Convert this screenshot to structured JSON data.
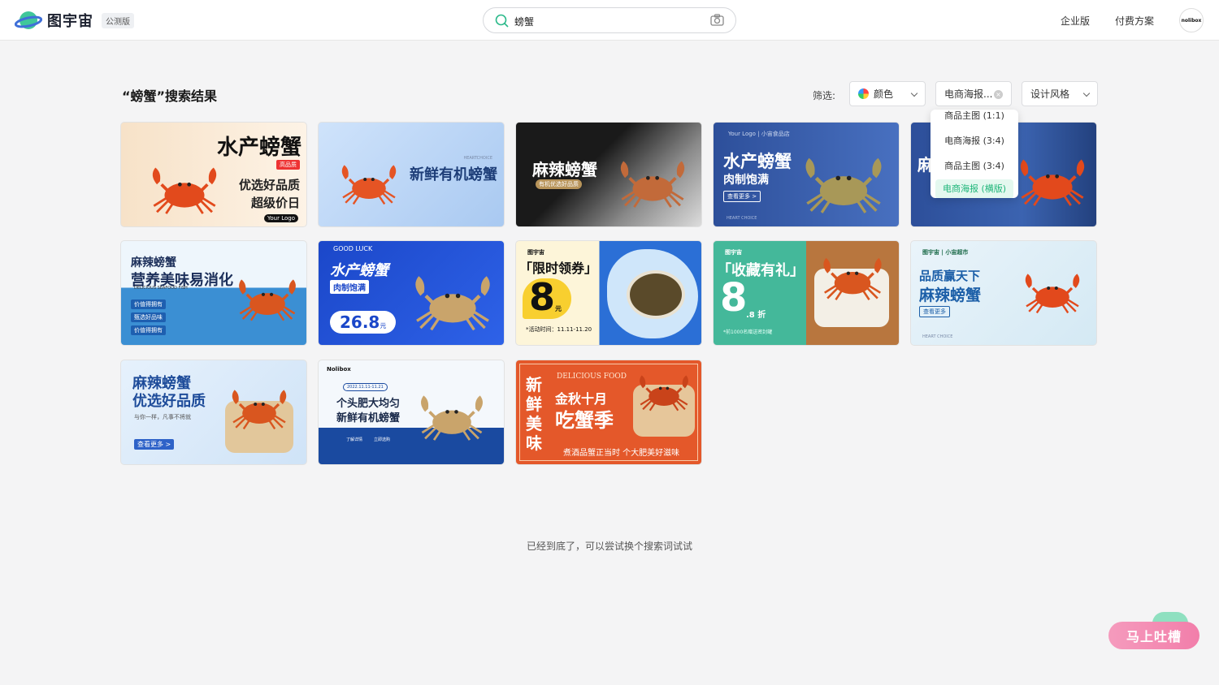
{
  "header": {
    "logo_text": "图宇宙",
    "beta_badge": "公测版",
    "search_value": "螃蟹",
    "nav": [
      "企业版",
      "付费方案"
    ],
    "avatar_text": "nolibox"
  },
  "results": {
    "title": "“螃蟹”搜索结果",
    "filter_label": "筛选:",
    "filters": {
      "color": "颜色",
      "type": "电商海报...",
      "style": "设计风格"
    },
    "dropdown_options": [
      "商品主图 (1:1)",
      "电商海报 (3:4)",
      "商品主图 (3:4)",
      "电商海报 (横版)"
    ],
    "end_text": "已经到底了，可以尝试换个搜索词试试"
  },
  "cards": [
    {
      "title": "水产螃蟹",
      "badge": "高品质",
      "line1": "优选好品质",
      "line2": "超级价日",
      "logo": "Your Logo"
    },
    {
      "title": "新鲜有机螃蟹",
      "small": "HEARTCHOICE"
    },
    {
      "title": "麻辣螃蟹",
      "tag": "有机优选好品质"
    },
    {
      "title": "水产螃蟹",
      "sub": "肉制饱满",
      "btn": "查看更多 >",
      "shop": "Your Logo | 小宙食品店",
      "foot": "HEART CHOICE"
    },
    {
      "title": "麻辣螃蟹"
    },
    {
      "title": "麻辣螃蟹",
      "sub": "营养美味易消化",
      "en": "DELICIOUS SEAFOOD FISH",
      "tags": [
        "价值得拥有",
        "甄选好品味",
        "价值得拥有"
      ]
    },
    {
      "title": "水产螃蟹",
      "sub": "肉制饱满",
      "price": "26.8",
      "unit": "元",
      "ring": "GOOD LUCK"
    },
    {
      "brand": "图宇宙",
      "title": "「限时领券」",
      "num": "8",
      "unit": "元",
      "date": "*活动时间：11.11-11.20"
    },
    {
      "brand": "图宇宙",
      "title": "「收藏有礼」",
      "num": "8",
      "unit": ".8 折",
      "foot": "*前1000名赠送密封罐"
    },
    {
      "brand": "图宇宙 | 小宙超市",
      "title": "品质赢天下",
      "sub": "麻辣螃蟹",
      "btn": "查看更多",
      "foot": "HEART CHOICE"
    },
    {
      "title": "麻辣螃蟹",
      "sub": "优选好品质",
      "small": "与你一样，凡事不将就",
      "btn": "查看更多 >"
    },
    {
      "brand": "Nolibox",
      "date": "2022.11.11-11.21",
      "title": "个头肥大均匀",
      "sub": "新鲜有机螃蟹",
      "btns": [
        "了解详情",
        "立即选购"
      ]
    },
    {
      "vert": "新鲜美味",
      "en": "DELICIOUS FOOD",
      "title": "金秋十月",
      "sub": "吃蟹季",
      "foot": "煮酒品蟹正当时 个大肥美好滋味"
    }
  ],
  "feedback_label": "马上吐槽"
}
